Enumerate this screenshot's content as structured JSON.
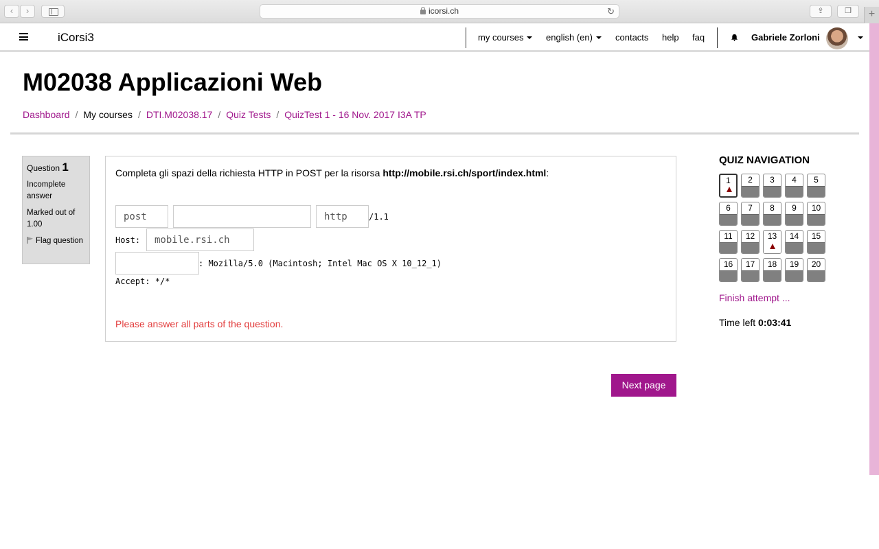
{
  "browser": {
    "url": "icorsi.ch",
    "back_icon": "chevron-left-icon",
    "forward_icon": "chevron-right-icon"
  },
  "header": {
    "brand": "iCorsi3",
    "nav": [
      {
        "label": "my courses",
        "dropdown": true
      },
      {
        "label": "english (en)",
        "dropdown": true
      },
      {
        "label": "contacts",
        "dropdown": false
      },
      {
        "label": "help",
        "dropdown": false
      },
      {
        "label": "faq",
        "dropdown": false
      }
    ],
    "user_name": "Gabriele Zorloni"
  },
  "page": {
    "title": "M02038 Applicazioni Web",
    "breadcrumb": [
      {
        "label": "Dashboard",
        "link": true
      },
      {
        "label": "My courses",
        "link": false
      },
      {
        "label": "DTI.M02038.17",
        "link": true
      },
      {
        "label": "Quiz Tests",
        "link": true
      },
      {
        "label": "QuizTest 1 - 16 Nov. 2017 I3A TP",
        "link": true
      }
    ]
  },
  "question_info": {
    "label": "Question",
    "number": "1",
    "status": "Incomplete answer",
    "marked": "Marked out of 1.00",
    "flag_label": "Flag question"
  },
  "question": {
    "text_prefix": "Completa gli spazi della richiesta HTTP in POST per la risorsa ",
    "text_url": "http://mobile.rsi.ch/sport/index.html",
    "text_suffix": ":",
    "field1_value": "post",
    "field2_value": "",
    "field3_value": "http",
    "http_version": "/1.1",
    "host_label": "Host:",
    "host_value": "mobile.rsi.ch",
    "field5_value": "",
    "user_agent_rest": ": Mozilla/5.0 (Macintosh; Intel Mac OS X 10_12_1)",
    "accept_line": "Accept: */*",
    "error": "Please answer all parts of the question."
  },
  "next_button": "Next page",
  "quiz_nav": {
    "title": "QUIZ NAVIGATION",
    "current": 1,
    "flagged": [
      1,
      13
    ],
    "questions": [
      "1",
      "2",
      "3",
      "4",
      "5",
      "6",
      "7",
      "8",
      "9",
      "10",
      "11",
      "12",
      "13",
      "14",
      "15",
      "16",
      "17",
      "18",
      "19",
      "20"
    ],
    "finish_label": "Finish attempt ...",
    "time_label": "Time left",
    "time_value": "0:03:41"
  },
  "colors": {
    "accent": "#a0178c",
    "error": "#e23c3c",
    "flag": "#8b0000",
    "answered_state": "#808080"
  }
}
